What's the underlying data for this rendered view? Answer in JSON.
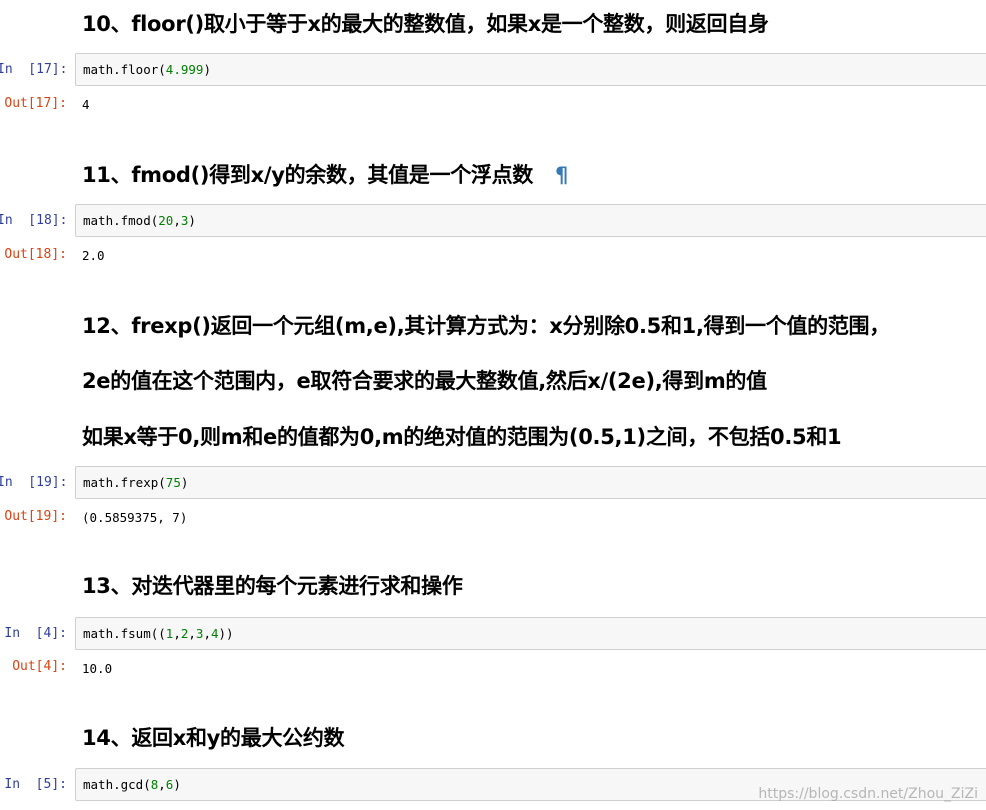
{
  "colors": {
    "in_prompt": "#303f9f",
    "out_prompt": "#d84315",
    "number_literal": "#008000",
    "anchor": "#337ab7",
    "cell_bg": "#f7f7f7"
  },
  "sections": [
    {
      "heading_lines": [
        "10、floor()取小于等于x的最大的整数值，如果x是一个整数，则返回自身"
      ],
      "in_prompt": "In  [17]:",
      "code": {
        "prefix": "math.floor(",
        "args": [
          "4.999"
        ],
        "suffix": ")"
      },
      "out_prompt": "Out[17]:",
      "output": "4"
    },
    {
      "heading_lines": [
        "11、fmod()得到x/y的余数，其值是一个浮点数"
      ],
      "anchor_icon": "pilcrow-icon",
      "anchor_glyph": "¶",
      "in_prompt": "In  [18]:",
      "code": {
        "prefix": "math.fmod(",
        "args": [
          "20",
          "3"
        ],
        "suffix": ")"
      },
      "out_prompt": "Out[18]:",
      "output": "2.0"
    },
    {
      "heading_lines": [
        "12、frexp()返回一个元组(m,e),其计算方式为：x分别除0.5和1,得到一个值的范围，",
        "2e的值在这个范围内，e取符合要求的最大整数值,然后x/(2e),得到m的值",
        "如果x等于0,则m和e的值都为0,m的绝对值的范围为(0.5,1)之间，不包括0.5和1"
      ],
      "in_prompt": "In  [19]:",
      "code": {
        "prefix": "math.frexp(",
        "args": [
          "75"
        ],
        "suffix": ")"
      },
      "out_prompt": "Out[19]:",
      "output": "(0.5859375, 7)"
    },
    {
      "heading_lines": [
        "13、对迭代器里的每个元素进行求和操作"
      ],
      "in_prompt": "In  [4]:",
      "code": {
        "prefix": "math.fsum((",
        "args": [
          "1",
          "2",
          "3",
          "4"
        ],
        "suffix": "))"
      },
      "out_prompt": "Out[4]:",
      "output": "10.0"
    },
    {
      "heading_lines": [
        "14、返回x和y的最大公约数"
      ],
      "in_prompt": "In  [5]:",
      "code": {
        "prefix": "math.gcd(",
        "args": [
          "8",
          "6"
        ],
        "suffix": ")"
      }
    }
  ],
  "watermark": "https://blog.csdn.net/Zhou_ZiZi"
}
